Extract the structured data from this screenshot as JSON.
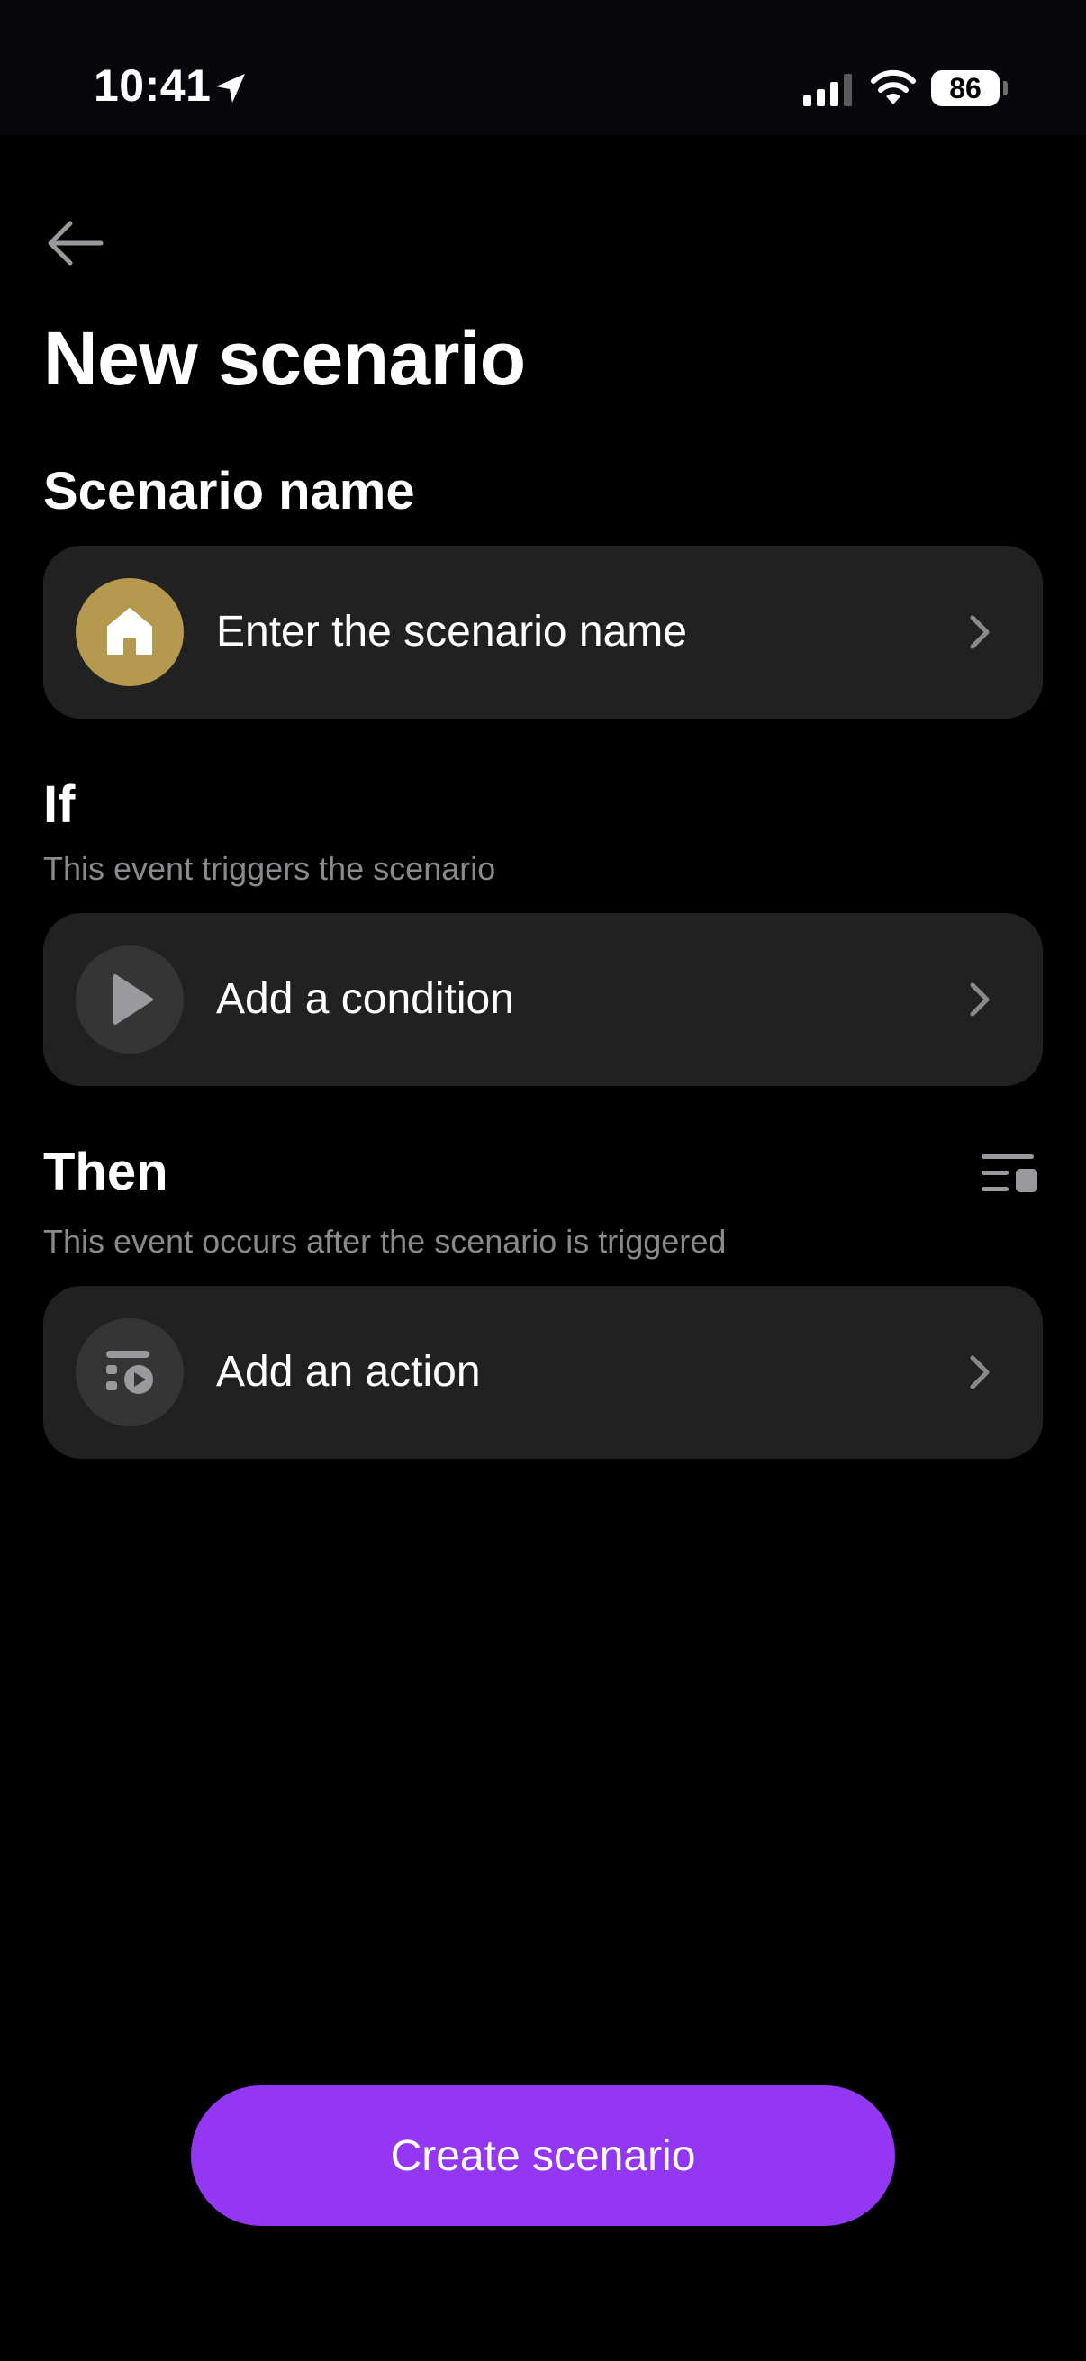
{
  "status_bar": {
    "time": "10:41",
    "battery": "86"
  },
  "header": {
    "title": "New scenario"
  },
  "scenario_name": {
    "title": "Scenario name",
    "placeholder": "Enter the scenario name",
    "icon": "home-icon",
    "icon_bg": "#b5994f"
  },
  "if_section": {
    "title": "If",
    "subtitle": "This event triggers the scenario",
    "row_label": "Add a condition",
    "icon": "play-icon"
  },
  "then_section": {
    "title": "Then",
    "subtitle": "This event occurs after the scenario is triggered",
    "row_label": "Add an action",
    "icon": "action-icon"
  },
  "footer": {
    "create_label": "Create scenario",
    "accent": "#9437f2"
  }
}
